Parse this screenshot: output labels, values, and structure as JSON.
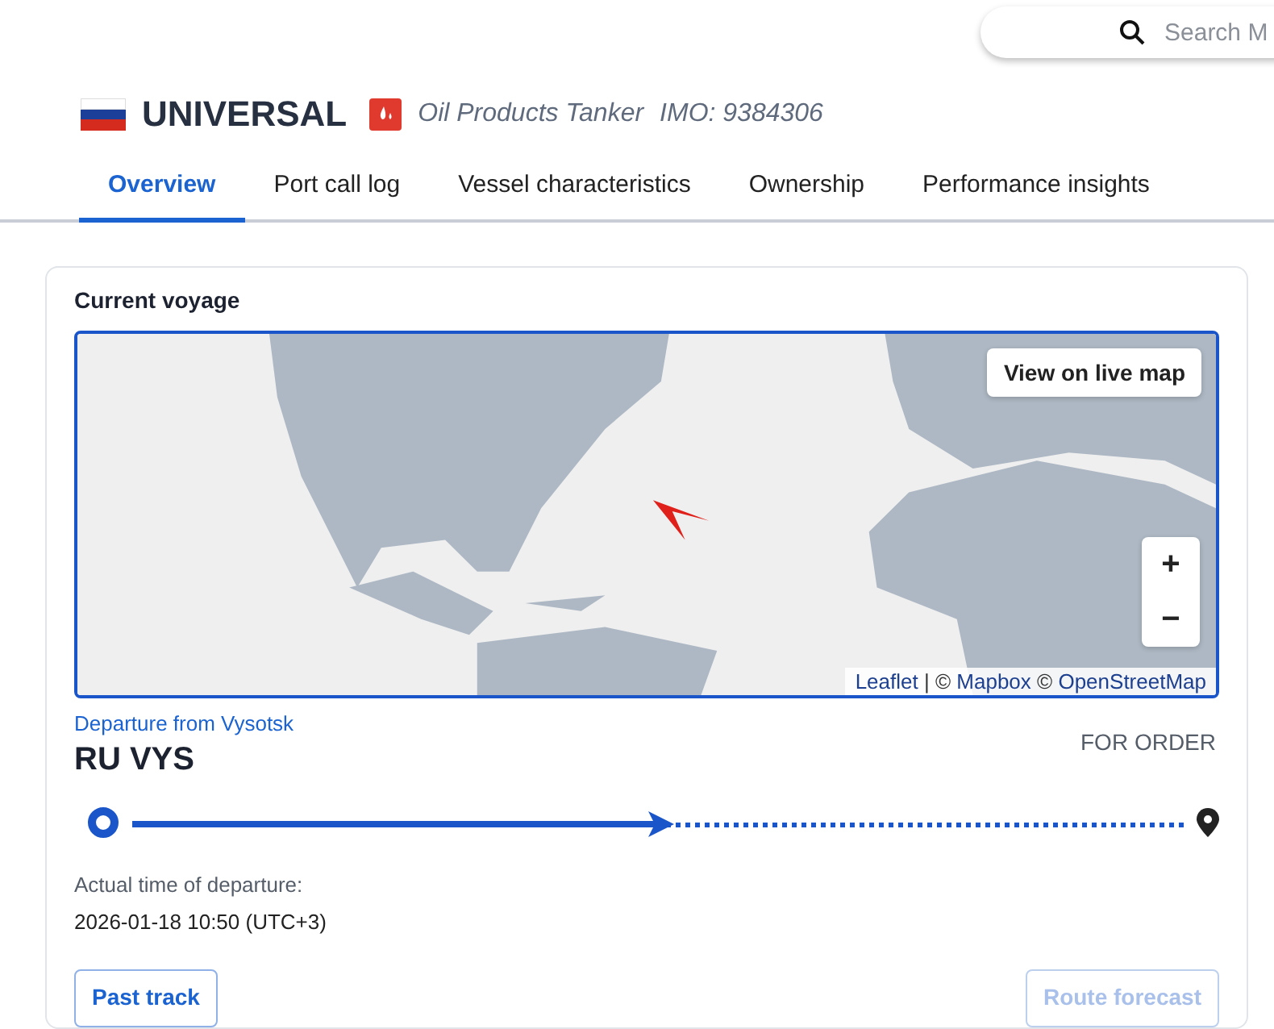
{
  "search": {
    "placeholder": "Search M"
  },
  "vessel": {
    "name": "UNIVERSAL",
    "type": "Oil Products Tanker",
    "imo": "IMO: 9384306"
  },
  "tabs": [
    {
      "label": "Overview",
      "selected": true
    },
    {
      "label": "Port call log",
      "selected": false
    },
    {
      "label": "Vessel characteristics",
      "selected": false
    },
    {
      "label": "Ownership",
      "selected": false
    },
    {
      "label": "Performance insights",
      "selected": false
    }
  ],
  "voyage": {
    "title": "Current voyage",
    "map": {
      "kind": "picture",
      "live_button": "View on live map",
      "zoom_in": "+",
      "zoom_out": "−",
      "attribution": [
        {
          "text": "Leaflet",
          "kind": "link"
        },
        {
          "text": " | © ",
          "kind": "plain"
        },
        {
          "text": "Mapbox",
          "kind": "link"
        },
        {
          "text": " © ",
          "kind": "plain"
        },
        {
          "text": "OpenStreetMap",
          "kind": "link"
        }
      ]
    },
    "departure_label": "Departure from Vysotsk",
    "origin": "RU VYS",
    "destination": "FOR ORDER",
    "progress": {
      "level": 0.5
    },
    "atd_label": "Actual time of departure:",
    "atd_value": "2026-01-18 10:50 (UTC+3)",
    "buttons": [
      {
        "label": "Past track",
        "disabled": false
      },
      {
        "label": "Route forecast",
        "disabled": true
      }
    ]
  }
}
